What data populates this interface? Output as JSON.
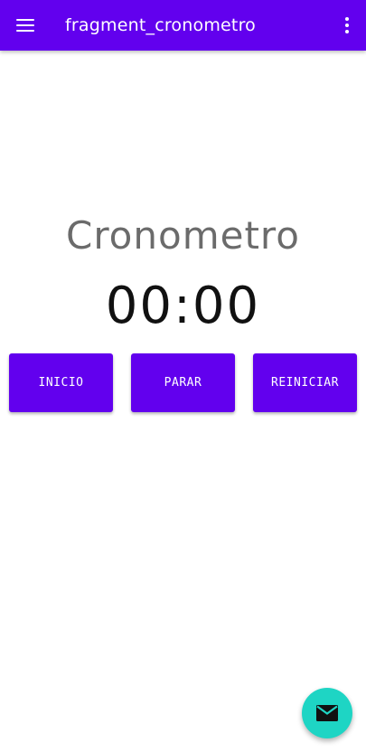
{
  "toolbar": {
    "title": "fragment_cronometro",
    "menu_icon": "menu-icon",
    "overflow_icon": "more-vert-icon",
    "color": "#6200ee"
  },
  "main": {
    "heading": "Cronometro",
    "time": "00:00"
  },
  "buttons": {
    "start_label": "INICIO",
    "stop_label": "PARAR",
    "reset_label": "REINICIAR",
    "color": "#6200ee"
  },
  "fab": {
    "icon": "email-icon",
    "color": "#1ed5c4"
  }
}
